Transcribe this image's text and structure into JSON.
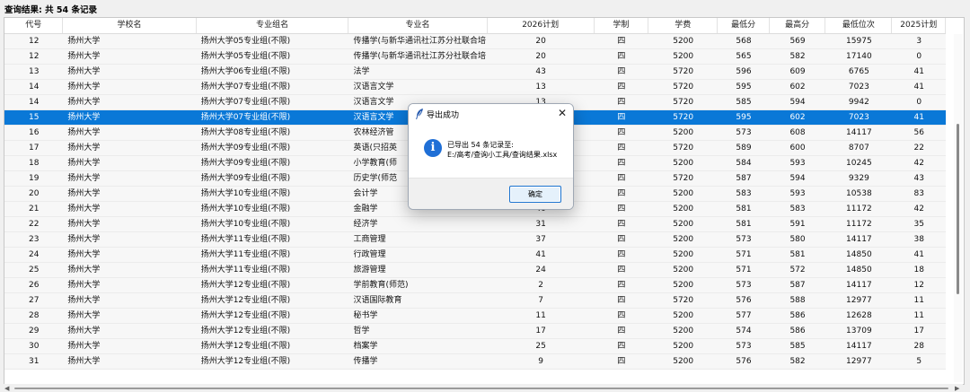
{
  "result_title": "查询结果: 共 54 条记录",
  "columns": [
    "代号",
    "学校名",
    "专业组名",
    "专业名",
    "2026计划",
    "学制",
    "学费",
    "最低分",
    "最高分",
    "最低位次",
    "2025计划"
  ],
  "rows": [
    [
      "12",
      "扬州大学",
      "扬州大学05专业组(不限)",
      "传播学(与新华通讯社江苏分社联合培",
      "20",
      "四",
      "5200",
      "568",
      "569",
      "15975",
      "3"
    ],
    [
      "12",
      "扬州大学",
      "扬州大学05专业组(不限)",
      "传播学(与新华通讯社江苏分社联合培",
      "20",
      "四",
      "5200",
      "565",
      "582",
      "17140",
      "0"
    ],
    [
      "13",
      "扬州大学",
      "扬州大学06专业组(不限)",
      "法学",
      "43",
      "四",
      "5720",
      "596",
      "609",
      "6765",
      "41"
    ],
    [
      "14",
      "扬州大学",
      "扬州大学07专业组(不限)",
      "汉语言文学",
      "13",
      "四",
      "5720",
      "595",
      "602",
      "7023",
      "41"
    ],
    [
      "14",
      "扬州大学",
      "扬州大学07专业组(不限)",
      "汉语言文学",
      "13",
      "四",
      "5720",
      "585",
      "594",
      "9942",
      "0"
    ],
    [
      "15",
      "扬州大学",
      "扬州大学07专业组(不限)",
      "汉语言文学",
      "",
      "四",
      "5720",
      "595",
      "602",
      "7023",
      "41"
    ],
    [
      "16",
      "扬州大学",
      "扬州大学08专业组(不限)",
      "农林经济管",
      "",
      "四",
      "5200",
      "573",
      "608",
      "14117",
      "56"
    ],
    [
      "17",
      "扬州大学",
      "扬州大学09专业组(不限)",
      "英语(只招英",
      "",
      "四",
      "5720",
      "589",
      "600",
      "8707",
      "22"
    ],
    [
      "18",
      "扬州大学",
      "扬州大学09专业组(不限)",
      "小学教育(师",
      "",
      "四",
      "5200",
      "584",
      "593",
      "10245",
      "42"
    ],
    [
      "19",
      "扬州大学",
      "扬州大学09专业组(不限)",
      "历史学(师范",
      "",
      "四",
      "5720",
      "587",
      "594",
      "9329",
      "43"
    ],
    [
      "20",
      "扬州大学",
      "扬州大学10专业组(不限)",
      "会计学",
      "",
      "四",
      "5200",
      "583",
      "593",
      "10538",
      "83"
    ],
    [
      "21",
      "扬州大学",
      "扬州大学10专业组(不限)",
      "金融学",
      "40",
      "四",
      "5200",
      "581",
      "583",
      "11172",
      "42"
    ],
    [
      "22",
      "扬州大学",
      "扬州大学10专业组(不限)",
      "经济学",
      "31",
      "四",
      "5200",
      "581",
      "591",
      "11172",
      "35"
    ],
    [
      "23",
      "扬州大学",
      "扬州大学11专业组(不限)",
      "工商管理",
      "37",
      "四",
      "5200",
      "573",
      "580",
      "14117",
      "38"
    ],
    [
      "24",
      "扬州大学",
      "扬州大学11专业组(不限)",
      "行政管理",
      "41",
      "四",
      "5200",
      "571",
      "581",
      "14850",
      "41"
    ],
    [
      "25",
      "扬州大学",
      "扬州大学11专业组(不限)",
      "旅游管理",
      "24",
      "四",
      "5200",
      "571",
      "572",
      "14850",
      "18"
    ],
    [
      "26",
      "扬州大学",
      "扬州大学12专业组(不限)",
      "学前教育(师范)",
      "2",
      "四",
      "5200",
      "573",
      "587",
      "14117",
      "12"
    ],
    [
      "27",
      "扬州大学",
      "扬州大学12专业组(不限)",
      "汉语国际教育",
      "7",
      "四",
      "5720",
      "576",
      "588",
      "12977",
      "11"
    ],
    [
      "28",
      "扬州大学",
      "扬州大学12专业组(不限)",
      "秘书学",
      "11",
      "四",
      "5200",
      "577",
      "586",
      "12628",
      "11"
    ],
    [
      "29",
      "扬州大学",
      "扬州大学12专业组(不限)",
      "哲学",
      "17",
      "四",
      "5200",
      "574",
      "586",
      "13709",
      "17"
    ],
    [
      "30",
      "扬州大学",
      "扬州大学12专业组(不限)",
      "档案学",
      "25",
      "四",
      "5200",
      "573",
      "585",
      "14117",
      "28"
    ],
    [
      "31",
      "扬州大学",
      "扬州大学12专业组(不限)",
      "传播学",
      "9",
      "四",
      "5200",
      "576",
      "582",
      "12977",
      "5"
    ]
  ],
  "selected_row": 5,
  "dialog": {
    "title": "导出成功",
    "close_symbol": "✕",
    "info_symbol": "i",
    "message_line1": "已导出 54 条记录至:",
    "message_line2": "E:/高考/查询小工具/查询结果.xlsx",
    "ok_label": "确定"
  },
  "colors": {
    "selection": "#0a78d7",
    "info_icon": "#1f6fd6",
    "feather_icon": "#2a5db0"
  }
}
